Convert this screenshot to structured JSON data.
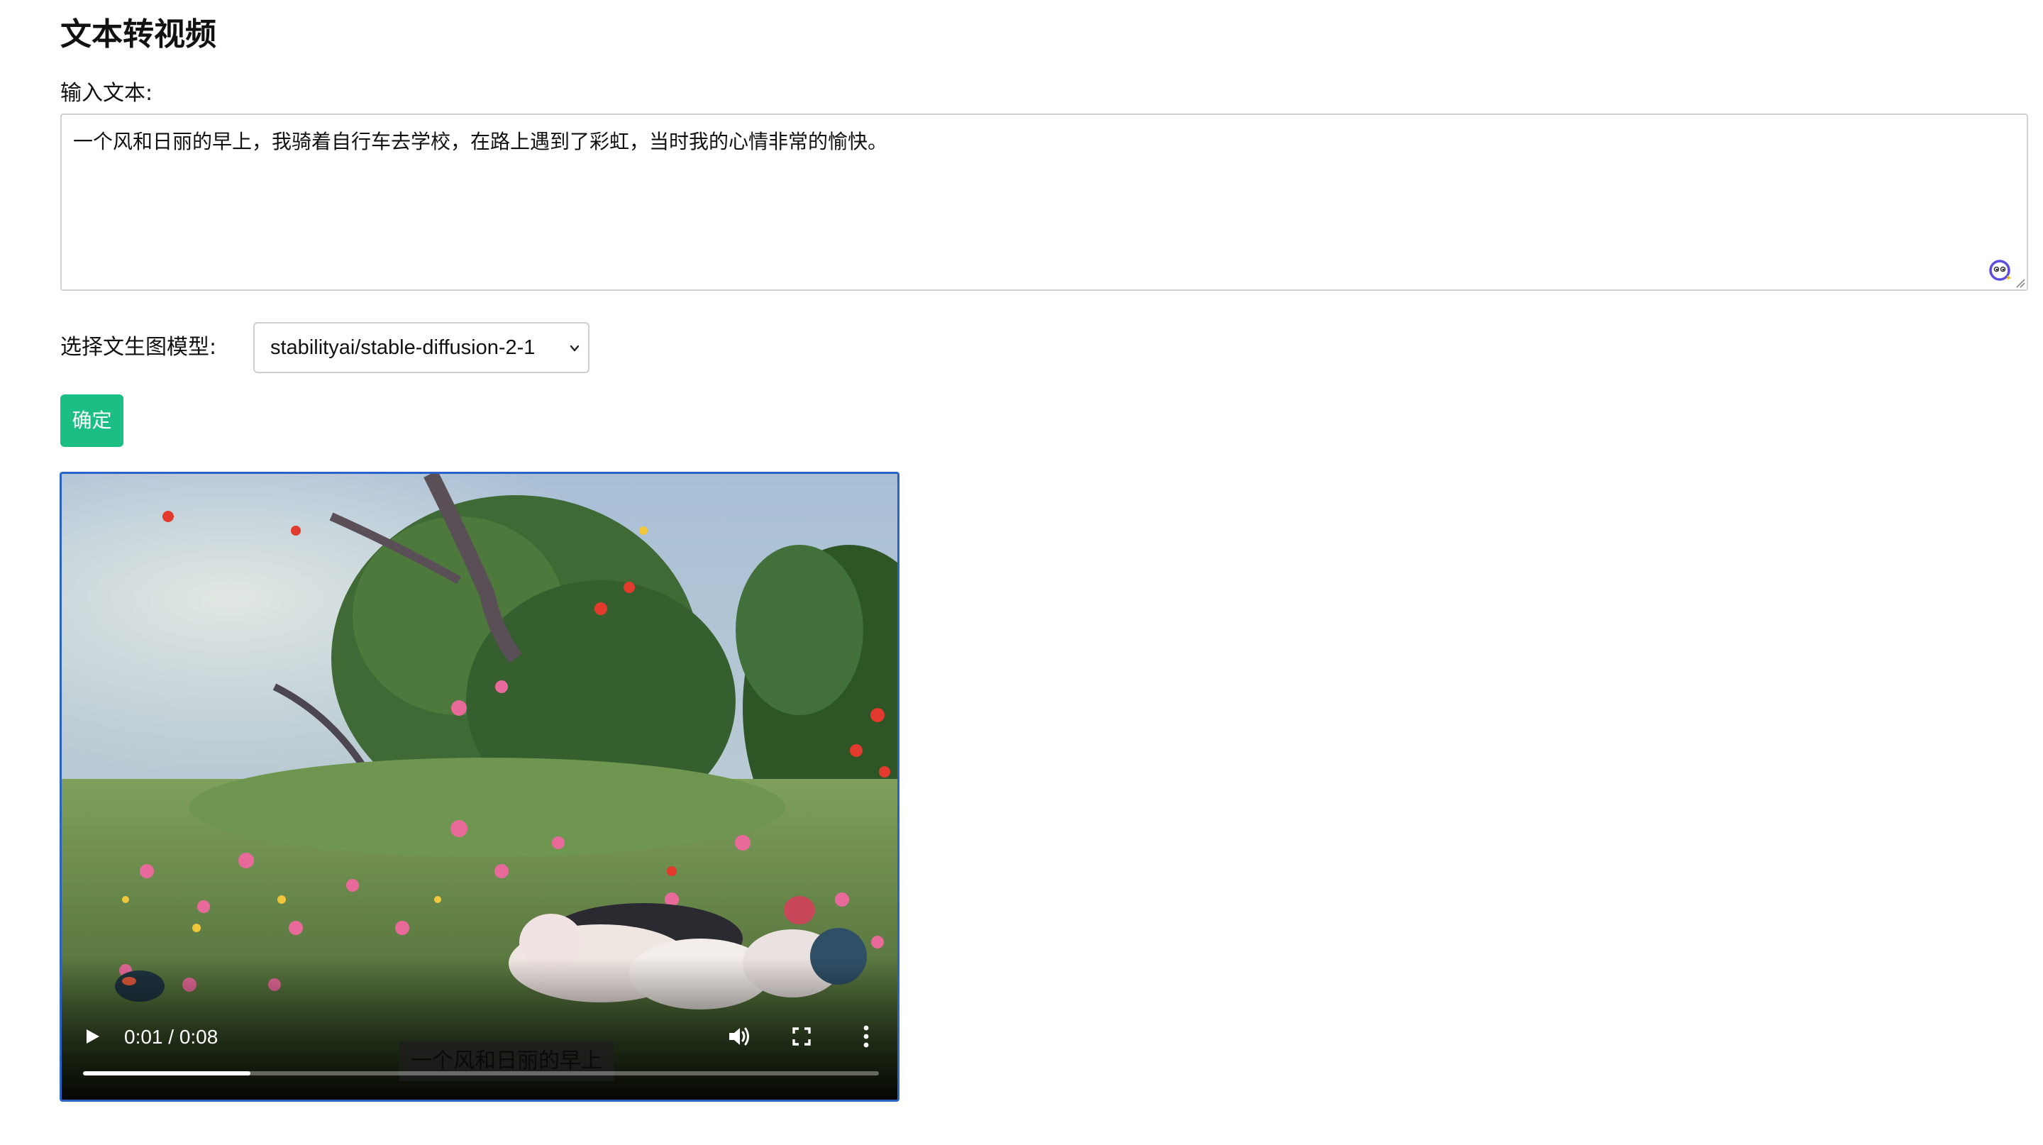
{
  "page": {
    "title": "文本转视频"
  },
  "text_input": {
    "label": "输入文本:",
    "value": "一个风和日丽的早上，我骑着自行车去学校，在路上遇到了彩虹，当时我的心情非常的愉快。"
  },
  "model_select": {
    "label": "选择文生图模型:",
    "selected": "stabilityai/stable-diffusion-2-1"
  },
  "confirm_button": {
    "label": "确定"
  },
  "video_player": {
    "caption": "一个风和日丽的早上",
    "time_display": "0:01 / 0:08",
    "current_time": "0:01",
    "duration": "0:08",
    "progress_fraction": 0.21
  },
  "colors": {
    "confirm_button_bg": "#1bbf83",
    "video_focus_border": "#2a63c8",
    "grammar_icon": "#5b4ce0"
  },
  "icons": {
    "grammar": "grammar-assistant-icon",
    "resize": "resize-handle-icon",
    "dropdown": "chevron-down-icon",
    "play": "play-icon",
    "volume": "volume-icon",
    "fullscreen": "fullscreen-icon",
    "more": "more-icon"
  }
}
